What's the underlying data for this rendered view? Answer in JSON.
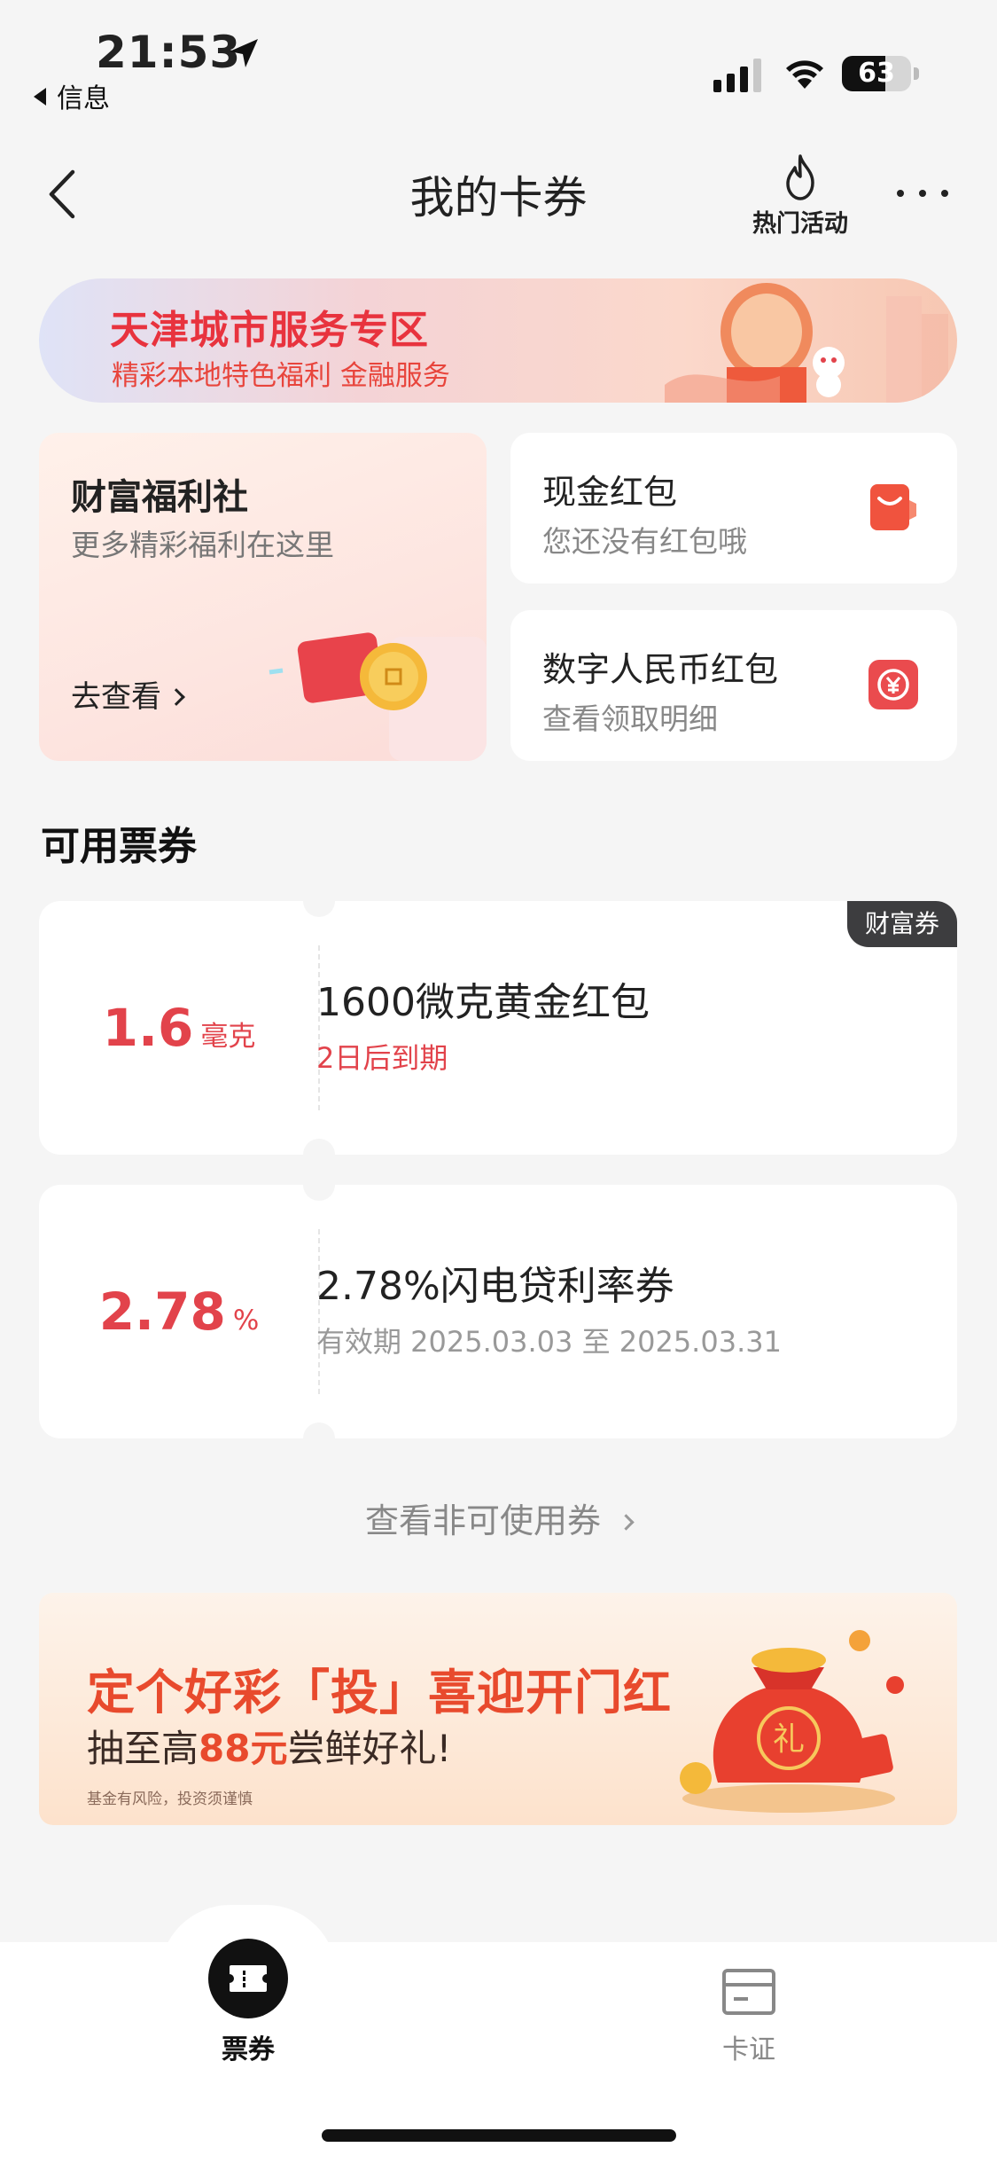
{
  "status_bar": {
    "time": "21:53",
    "back_app": "信息",
    "battery": "63",
    "battery_level_percent": 63
  },
  "nav": {
    "title": "我的卡券",
    "hot_label": "热门活动"
  },
  "banner": {
    "title": "天津城市服务专区",
    "subtitle": "精彩本地特色福利 金融服务"
  },
  "wealth_card": {
    "title": "财富福利社",
    "subtitle": "更多精彩福利在这里",
    "link": "去查看"
  },
  "cash_card": {
    "title": "现金红包",
    "subtitle": "您还没有红包哦"
  },
  "digital_card": {
    "title": "数字人民币红包",
    "subtitle": "查看领取明细"
  },
  "section_title": "可用票券",
  "coupons": [
    {
      "amount": "1.6",
      "unit": "毫克",
      "title": "1600微克黄金红包",
      "subtitle": "2日后到期",
      "tag": "财富券"
    },
    {
      "amount": "2.78",
      "unit": "%",
      "title": "2.78%闪电贷利率券",
      "subtitle": "有效期 2025.03.03 至 2025.03.31"
    }
  ],
  "non_usable_link": "查看非可使用券",
  "ad": {
    "title": "定个好彩「投」喜迎开门红",
    "subtitle_pre": "抽至高",
    "subtitle_hl": "88元",
    "subtitle_post": "尝鲜好礼!",
    "risk": "基金有风险，投资须谨慎",
    "bag_char": "礼"
  },
  "tabs": [
    {
      "label": "票券",
      "icon": "ticket-icon",
      "active": true
    },
    {
      "label": "卡证",
      "icon": "card-icon",
      "active": false
    }
  ],
  "colors": {
    "accent_red": "#e2434b",
    "background": "#f5f5f5",
    "tag_dark": "#3d3d3f"
  }
}
